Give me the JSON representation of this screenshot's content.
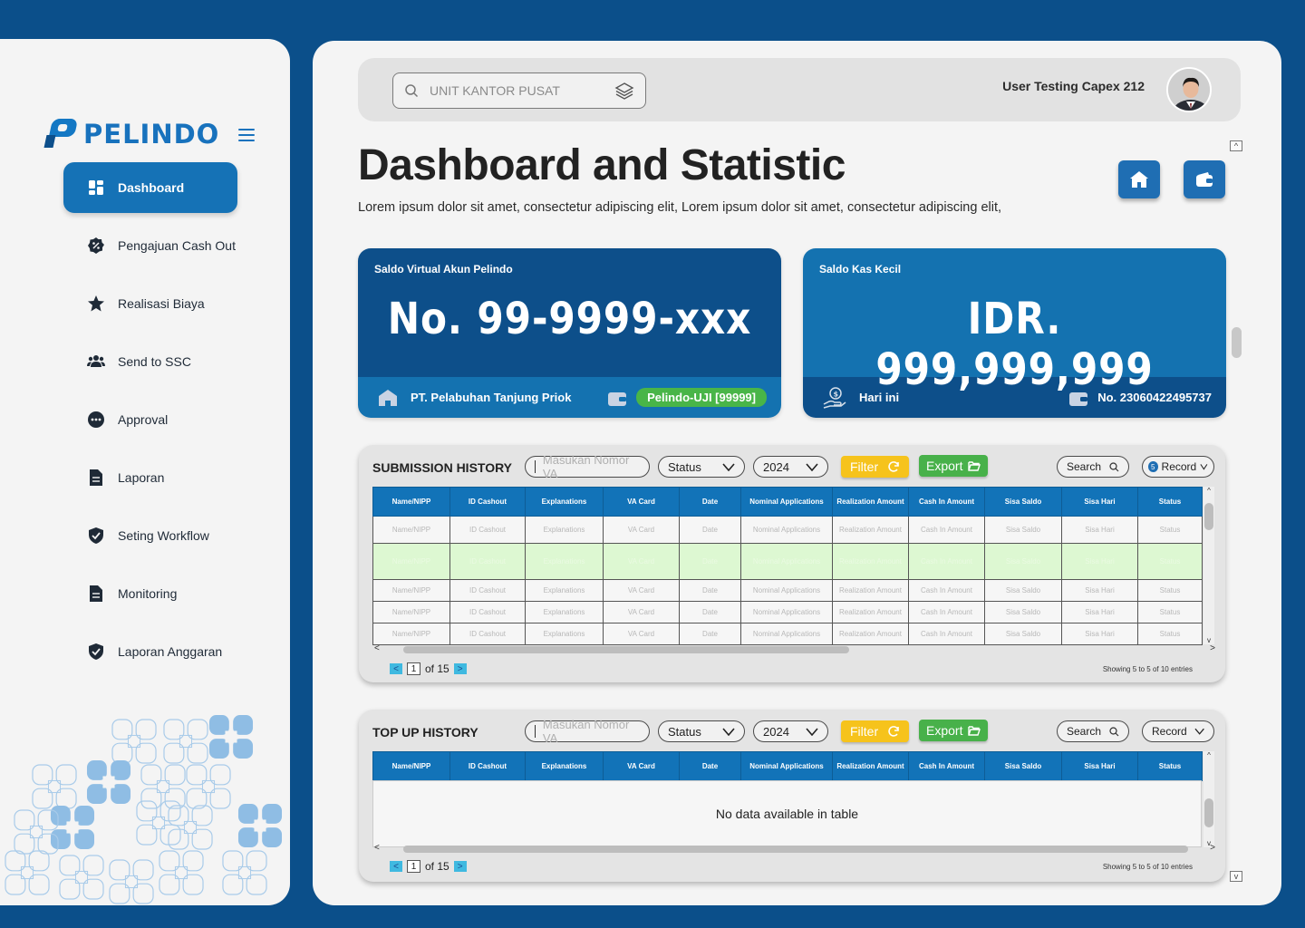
{
  "brand": {
    "name": "PELINDO"
  },
  "sidebar": {
    "items": [
      {
        "label": "Dashboard",
        "icon": "dashboard-icon",
        "active": true
      },
      {
        "label": "Pengajuan Cash Out",
        "icon": "percent-badge-icon"
      },
      {
        "label": "Realisasi Biaya",
        "icon": "star-icon"
      },
      {
        "label": "Send to SSC",
        "icon": "users-icon"
      },
      {
        "label": "Approval",
        "icon": "more-icon"
      },
      {
        "label": "Laporan",
        "icon": "document-icon"
      },
      {
        "label": "Seting Workflow",
        "icon": "shield-check-icon"
      },
      {
        "label": "Monitoring",
        "icon": "document-icon"
      },
      {
        "label": "Laporan Anggaran",
        "icon": "shield-check-icon"
      }
    ]
  },
  "header": {
    "unit_placeholder": "UNIT KANTOR PUSAT",
    "user_name": "User Testing Capex 212"
  },
  "page": {
    "title": "Dashboard and Statistic",
    "subtitle": "Lorem ipsum dolor sit amet, consectetur adipiscing elit, Lorem ipsum dolor sit amet, consectetur adipiscing elit,"
  },
  "cards": {
    "virtual": {
      "label": "Saldo Virtual Akun Pelindo",
      "value": "No. 99-9999-xxx",
      "company": "PT. Pelabuhan Tanjung Priok",
      "account": "Pelindo-UJI [99999]"
    },
    "petty": {
      "label": "Saldo Kas Kecil",
      "value": "IDR. 999,999,999",
      "period": "Hari ini",
      "account": "No. 23060422495737"
    }
  },
  "submission": {
    "title": "SUBMISSION HISTORY",
    "va_placeholder": "Masukan Nomor VA",
    "status": "Status",
    "year": "2024",
    "filter": "Filter",
    "export": "Export",
    "search": "Search",
    "record_count": "5",
    "record": "Record",
    "columns": [
      "Name/NIPP",
      "ID Cashout",
      "Explanations",
      "VA Card",
      "Date",
      "Nominal Applications",
      "Realization Amount",
      "Cash In Amount",
      "Sisa Saldo",
      "Sisa Hari",
      "Status"
    ],
    "rows": [
      [
        "Name/NIPP",
        "ID Cashout",
        "Explanations",
        "VA Card",
        "Date",
        "Nominal Applications",
        "Realization Amount",
        "Cash In Amount",
        "Sisa Saldo",
        "Sisa Hari",
        "Status"
      ],
      [
        "Name/NIPP",
        "ID Cashout",
        "Explanations",
        "VA Card",
        "Date",
        "Nominal Applications",
        "Realization Amount",
        "Cash In Amount",
        "Sisa Saldo",
        "Sisa Hari",
        "Status"
      ],
      [
        "Name/NIPP",
        "ID Cashout",
        "Explanations",
        "VA Card",
        "Date",
        "Nominal Applications",
        "Realization Amount",
        "Cash In Amount",
        "Sisa Saldo",
        "Sisa Hari",
        "Status"
      ],
      [
        "Name/NIPP",
        "ID Cashout",
        "Explanations",
        "VA Card",
        "Date",
        "Nominal Applications",
        "Realization Amount",
        "Cash In Amount",
        "Sisa Saldo",
        "Sisa Hari",
        "Status"
      ],
      [
        "Name/NIPP",
        "ID Cashout",
        "Explanations",
        "VA Card",
        "Date",
        "Nominal Applications",
        "Realization Amount",
        "Cash In Amount",
        "Sisa Saldo",
        "Sisa Hari",
        "Status"
      ]
    ],
    "highlighted_row": 1,
    "page": "1",
    "of_pages": "of 15",
    "entries": "Showing 5 to 5 of 10 entries"
  },
  "topup": {
    "title": "TOP UP HISTORY",
    "va_placeholder": "Masukan Nomor VA",
    "status": "Status",
    "year": "2024",
    "filter": "Filter",
    "export": "Export",
    "search": "Search",
    "record": "Record",
    "columns": [
      "Name/NIPP",
      "ID Cashout",
      "Explanations",
      "VA Card",
      "Date",
      "Nominal Applications",
      "Realization Amount",
      "Cash In Amount",
      "Sisa Saldo",
      "Sisa Hari",
      "Status"
    ],
    "empty": "No data available in table",
    "page": "1",
    "of_pages": "of 15",
    "entries": "Showing 5 to 5 of 10 entries"
  },
  "colors": {
    "primary": "#1273b8",
    "dark_blue": "#0b4f8a",
    "card_virtual": "#0d4f8a",
    "card_petty": "#1472b0",
    "filter": "#f6c31c",
    "export": "#48b14a",
    "highlight_row": "#ddf8d2"
  }
}
